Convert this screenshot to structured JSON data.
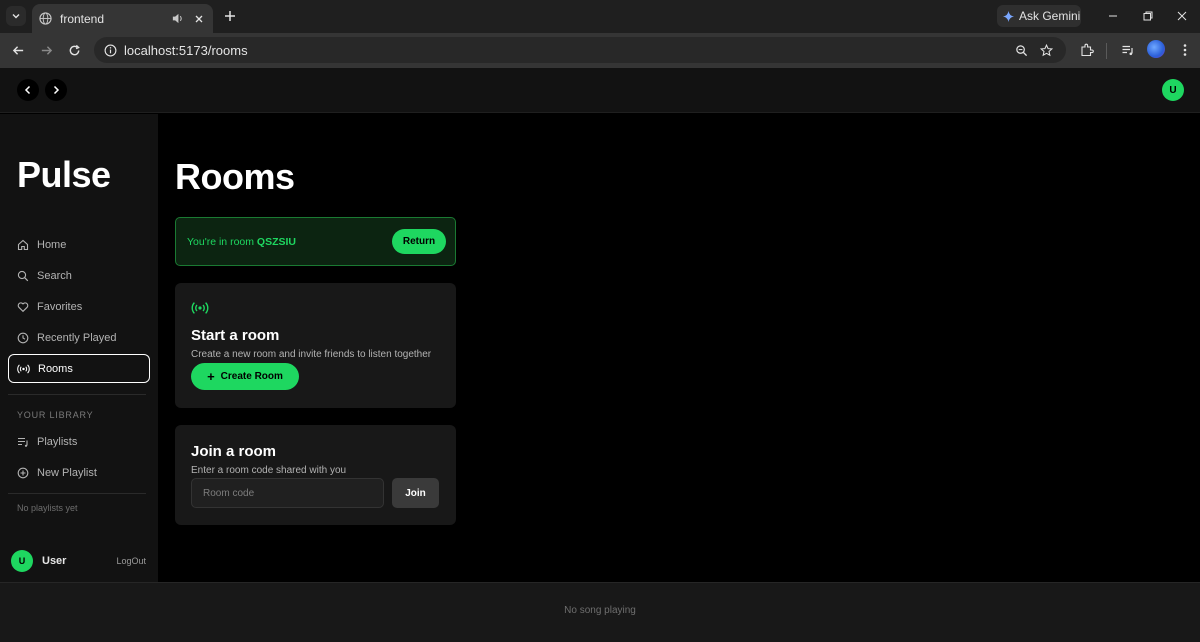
{
  "browser": {
    "tab_title": "frontend",
    "url": "localhost:5173/rooms",
    "ask_gemini_label": "Ask Gemini"
  },
  "app": {
    "brand": "Pulse",
    "top_avatar_initial": "U",
    "sidebar": {
      "nav_items": [
        {
          "label": "Home",
          "icon": "home-icon"
        },
        {
          "label": "Search",
          "icon": "search-icon"
        },
        {
          "label": "Favorites",
          "icon": "heart-icon"
        },
        {
          "label": "Recently Played",
          "icon": "clock-icon"
        },
        {
          "label": "Rooms",
          "icon": "broadcast-icon",
          "active": true
        }
      ],
      "library_label": "YOUR LIBRARY",
      "library_items": [
        {
          "label": "Playlists",
          "icon": "playlist-icon"
        },
        {
          "label": "New Playlist",
          "icon": "plus-circle-icon"
        }
      ],
      "no_playlists": "No playlists yet",
      "user": {
        "initial": "U",
        "name": "User",
        "logout_label": "LogOut"
      }
    },
    "main": {
      "title": "Rooms",
      "banner": {
        "prefix": "You're in room ",
        "room_code": "QSZSIU",
        "return_label": "Return"
      },
      "start_card": {
        "title": "Start a room",
        "subtitle": "Create a new room and invite friends to listen together",
        "button_label": "Create Room"
      },
      "join_card": {
        "title": "Join a room",
        "subtitle": "Enter a room code shared with you",
        "input_placeholder": "Room code",
        "input_value": "",
        "button_label": "Join"
      }
    },
    "player": {
      "status": "No song playing"
    },
    "colors": {
      "accent": "#1ed760",
      "background": "#000000",
      "surface": "#181818"
    }
  }
}
